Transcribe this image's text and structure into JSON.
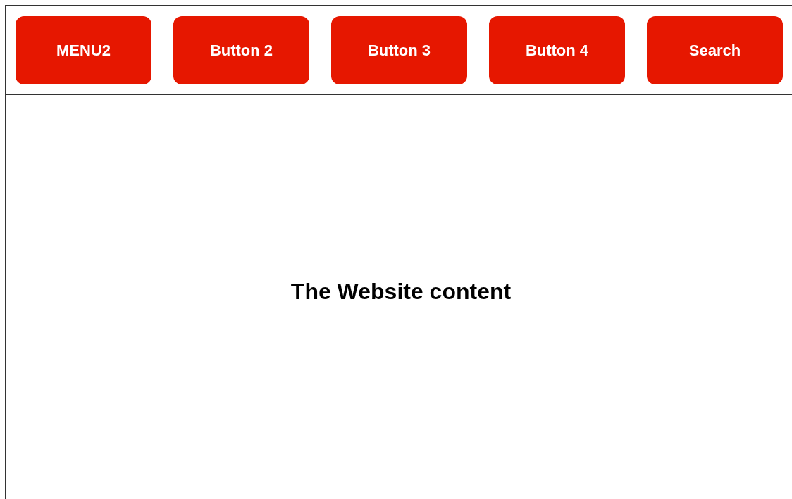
{
  "nav_buttons": [
    {
      "label": "MENU2"
    },
    {
      "label": "Button 2"
    },
    {
      "label": "Button 3"
    },
    {
      "label": "Button 4"
    },
    {
      "label": "Search"
    }
  ],
  "content": {
    "heading": "The Website content"
  }
}
